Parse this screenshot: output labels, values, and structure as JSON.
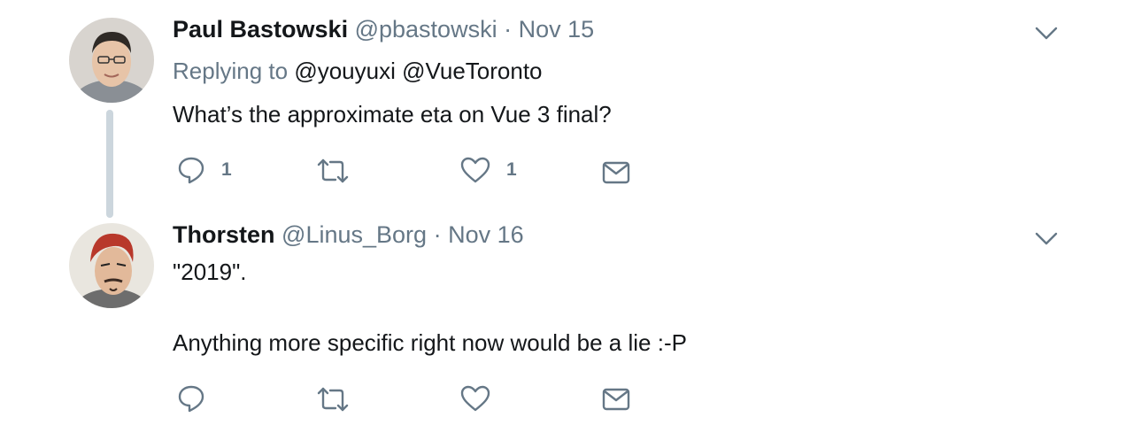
{
  "thread": [
    {
      "author_name": "Paul Bastowski",
      "handle": "@pbastowski",
      "separator": "·",
      "date": "Nov 15",
      "replying_prefix": "Replying to",
      "replying_mentions": [
        "@youyuxi",
        "@VueToronto"
      ],
      "text_lines": [
        "What’s the approximate eta on Vue 3 final?"
      ],
      "actions": {
        "reply_count": "1",
        "retweet_count": "",
        "like_count": "1"
      },
      "avatar_icon": "avatar-photo"
    },
    {
      "author_name": "Thorsten",
      "handle": "@Linus_Borg",
      "separator": "·",
      "date": "Nov 16",
      "text_lines": [
        "\"2019\".",
        "Anything more specific right now would be a lie :-P"
      ],
      "actions": {
        "reply_count": "",
        "retweet_count": "",
        "like_count": ""
      },
      "avatar_icon": "avatar-photo"
    }
  ],
  "icons": {
    "reply": "reply-icon",
    "retweet": "retweet-icon",
    "like": "heart-icon",
    "dm": "envelope-icon",
    "more": "chevron-down-icon"
  },
  "colors": {
    "secondary_text": "#657786",
    "primary_text": "#14171a",
    "thread_line": "#ccd6dd",
    "icon_gray": "#657786"
  }
}
